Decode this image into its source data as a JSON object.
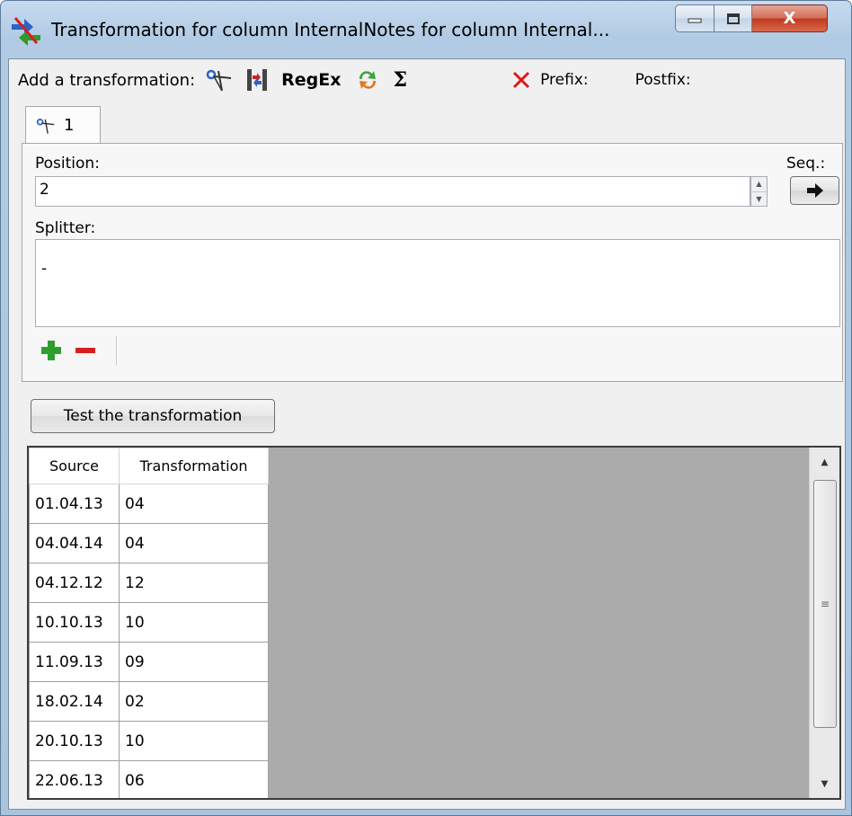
{
  "window": {
    "title": "Transformation for column InternalNotes for column Internal...",
    "close_label": "X"
  },
  "toolbar": {
    "add_label": "Add a transformation:",
    "tools": [
      {
        "icon": "scissors-icon"
      },
      {
        "icon": "column-split-icon"
      },
      {
        "label": "RegEx"
      },
      {
        "icon": "replace-icon"
      },
      {
        "label": "Σ"
      }
    ],
    "prefix_label": "Prefix:",
    "postfix_label": "Postfix:"
  },
  "tab": {
    "label": "1",
    "icon": "scissors-icon"
  },
  "form": {
    "position_label": "Position:",
    "position_value": "2",
    "seq_label": "Seq.:",
    "splitter_label": "Splitter:",
    "splitter_items": [
      "-"
    ]
  },
  "test_button_label": "Test the transformation",
  "grid": {
    "columns": [
      "Source",
      "Transformation"
    ],
    "rows": [
      [
        "01.04.13",
        "04"
      ],
      [
        "04.04.14",
        "04"
      ],
      [
        "04.12.12",
        "12"
      ],
      [
        "10.10.13",
        "10"
      ],
      [
        "11.09.13",
        "09"
      ],
      [
        "18.02.14",
        "02"
      ],
      [
        "20.10.13",
        "10"
      ],
      [
        "22.06.13",
        "06"
      ]
    ]
  },
  "colors": {
    "accent_close": "#c2391c",
    "add_green": "#2e9e2e",
    "remove_red": "#d42020",
    "grid_background": "#ababab"
  }
}
